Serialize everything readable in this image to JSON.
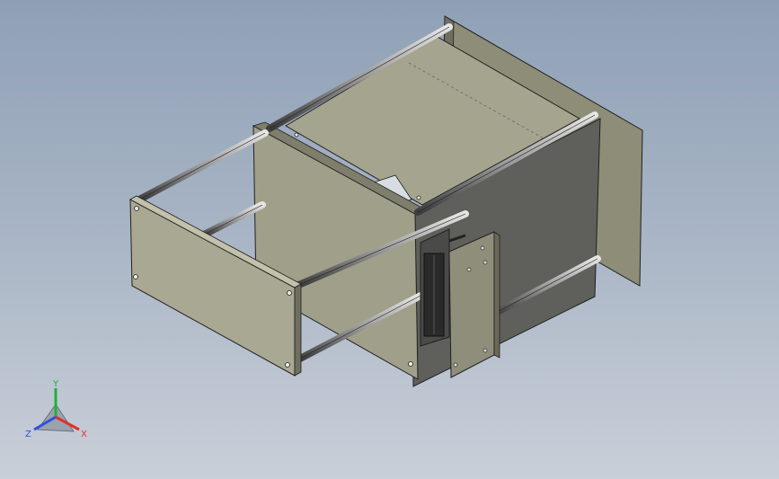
{
  "viewport": {
    "background_top": "#8fa0b6",
    "background_bottom": "#c9cfd8",
    "model_colors": {
      "panel_light": "#a7a690",
      "panel_mid": "#8e8d78",
      "panel_dark": "#5e5e5a",
      "rod": "#b8b8b8",
      "edge": "#202020"
    }
  },
  "triad": {
    "x_label": "X",
    "y_label": "Y",
    "z_label": "Z",
    "x_color": "#e03030",
    "y_color": "#20b040",
    "z_color": "#3050e0"
  }
}
